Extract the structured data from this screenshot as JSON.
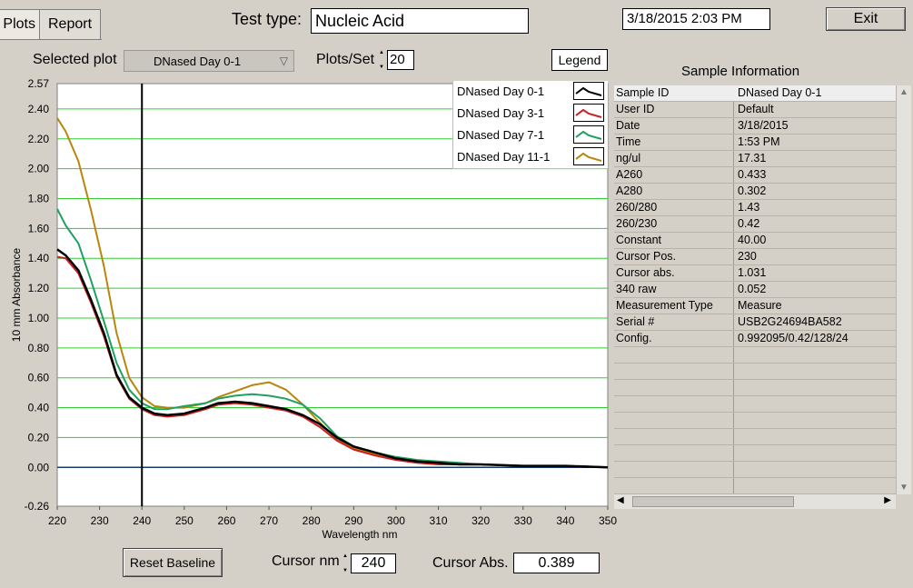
{
  "tabs": [
    {
      "label": "Plots"
    },
    {
      "label": "Report"
    }
  ],
  "header": {
    "test_type_label": "Test type:",
    "test_type_value": "Nucleic Acid",
    "datetime": "3/18/2015  2:03 PM",
    "exit_label": "Exit"
  },
  "controls": {
    "selected_plot_label": "Selected plot",
    "selected_plot_value": "DNased Day 0-1",
    "plots_per_set_label": "Plots/Set",
    "plots_per_set_value": "20",
    "legend_button": "Legend"
  },
  "chart_data": {
    "type": "line",
    "xlabel": "Wavelength nm",
    "ylabel": "10 mm Absorbance",
    "xlim": [
      220,
      350
    ],
    "ylim": [
      -0.26,
      2.57
    ],
    "x_ticks": [
      "220",
      "230",
      "240",
      "250",
      "260",
      "270",
      "280",
      "290",
      "300",
      "310",
      "320",
      "330",
      "340",
      "350"
    ],
    "y_ticks": [
      "-0.26",
      "0.00",
      "0.20",
      "0.40",
      "0.60",
      "0.80",
      "1.00",
      "1.20",
      "1.40",
      "1.60",
      "1.80",
      "2.00",
      "2.20",
      "2.40",
      "2.57"
    ],
    "grid": "horizontal",
    "cursor_x": 240,
    "series": [
      {
        "name": "DNased Day 0-1",
        "color": "#000000",
        "x": [
          220,
          222,
          225,
          228,
          231,
          234,
          237,
          240,
          243,
          246,
          250,
          255,
          258,
          262,
          266,
          270,
          274,
          278,
          282,
          286,
          290,
          295,
          300,
          305,
          310,
          315,
          320,
          330,
          340,
          350
        ],
        "y": [
          1.46,
          1.42,
          1.32,
          1.12,
          0.9,
          0.62,
          0.47,
          0.4,
          0.36,
          0.35,
          0.36,
          0.4,
          0.43,
          0.44,
          0.43,
          0.41,
          0.39,
          0.35,
          0.29,
          0.2,
          0.14,
          0.1,
          0.06,
          0.04,
          0.03,
          0.02,
          0.02,
          0.01,
          0.01,
          0.0
        ]
      },
      {
        "name": "DNased Day 3-1",
        "color": "#cc2020",
        "x": [
          220,
          222,
          225,
          228,
          231,
          234,
          237,
          240,
          243,
          246,
          250,
          255,
          258,
          262,
          266,
          270,
          274,
          278,
          282,
          286,
          290,
          295,
          300,
          305,
          310,
          315,
          320,
          330,
          340,
          350
        ],
        "y": [
          1.41,
          1.4,
          1.3,
          1.1,
          0.88,
          0.61,
          0.46,
          0.39,
          0.35,
          0.34,
          0.35,
          0.39,
          0.42,
          0.43,
          0.42,
          0.4,
          0.38,
          0.34,
          0.27,
          0.18,
          0.12,
          0.08,
          0.05,
          0.03,
          0.02,
          0.02,
          0.02,
          0.01,
          0.01,
          0.0
        ]
      },
      {
        "name": "DNased Day 7-1",
        "color": "#20a060",
        "x": [
          220,
          222,
          225,
          228,
          231,
          234,
          237,
          240,
          243,
          246,
          250,
          255,
          258,
          262,
          266,
          270,
          274,
          278,
          282,
          286,
          290,
          295,
          300,
          305,
          310,
          315,
          320,
          330,
          340,
          350
        ],
        "y": [
          1.73,
          1.62,
          1.5,
          1.25,
          0.98,
          0.7,
          0.52,
          0.43,
          0.39,
          0.39,
          0.41,
          0.43,
          0.46,
          0.48,
          0.49,
          0.48,
          0.46,
          0.42,
          0.33,
          0.21,
          0.14,
          0.1,
          0.07,
          0.05,
          0.04,
          0.03,
          0.02,
          0.01,
          0.01,
          0.0
        ]
      },
      {
        "name": "DNased Day 11-1",
        "color": "#b8860b",
        "x": [
          220,
          222,
          225,
          228,
          231,
          234,
          237,
          240,
          243,
          246,
          250,
          255,
          258,
          262,
          266,
          270,
          274,
          278,
          282,
          286,
          290,
          295,
          300,
          305,
          310,
          315,
          320,
          330,
          340,
          350
        ],
        "y": [
          2.34,
          2.25,
          2.05,
          1.72,
          1.35,
          0.9,
          0.6,
          0.47,
          0.41,
          0.4,
          0.4,
          0.43,
          0.47,
          0.51,
          0.55,
          0.57,
          0.52,
          0.42,
          0.3,
          0.19,
          0.13,
          0.09,
          0.06,
          0.04,
          0.03,
          0.02,
          0.02,
          0.01,
          0.01,
          0.0
        ]
      }
    ]
  },
  "sample_info": {
    "title": "Sample Information",
    "rows": [
      {
        "key": "Sample ID",
        "value": "DNased Day 0-1"
      },
      {
        "key": "User ID",
        "value": "Default"
      },
      {
        "key": "Date",
        "value": "3/18/2015"
      },
      {
        "key": "Time",
        "value": "1:53 PM"
      },
      {
        "key": "ng/ul",
        "value": " 17.31"
      },
      {
        "key": "A260",
        "value": " 0.433"
      },
      {
        "key": "A280",
        "value": " 0.302"
      },
      {
        "key": "260/280",
        "value": "  1.43"
      },
      {
        "key": "260/230",
        "value": "  0.42"
      },
      {
        "key": "Constant",
        "value": " 40.00"
      },
      {
        "key": "Cursor Pos.",
        "value": " 230"
      },
      {
        "key": "Cursor abs.",
        "value": " 1.031"
      },
      {
        "key": "340 raw",
        "value": " 0.052"
      },
      {
        "key": "Measurement Type",
        "value": "Measure"
      },
      {
        "key": "Serial #",
        "value": "USB2G24694BA582"
      },
      {
        "key": "Config.",
        "value": "0.992095/0.42/128/24"
      }
    ]
  },
  "footer": {
    "reset_baseline": "Reset Baseline",
    "cursor_nm_label": "Cursor nm",
    "cursor_nm_value": "240",
    "cursor_abs_label": "Cursor Abs.",
    "cursor_abs_value": "0.389"
  }
}
